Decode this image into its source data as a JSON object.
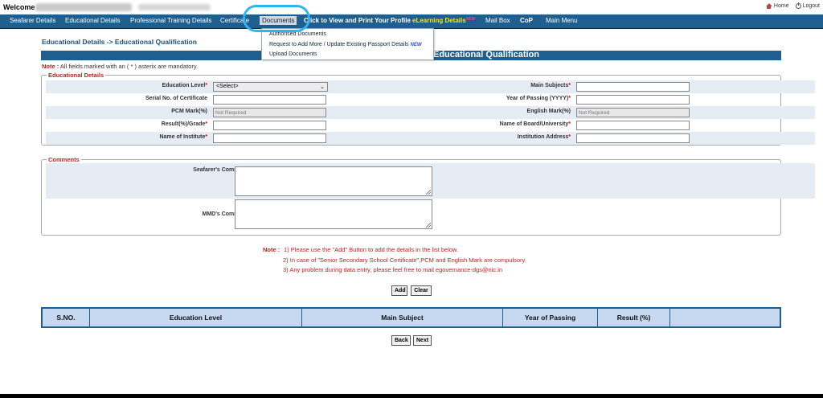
{
  "topbar": {
    "welcome": "Welcome",
    "home": "Home",
    "logout": "Logout"
  },
  "nav": {
    "items": [
      {
        "label": "Seafarer Details"
      },
      {
        "label": "Educational Details"
      },
      {
        "label": "Professional Training Details"
      },
      {
        "label": "Certificate"
      },
      {
        "label": "Documents"
      },
      {
        "label": "Click to View and Print Your Profile"
      },
      {
        "label": "eLearning Details"
      },
      {
        "label": "Mail Box"
      },
      {
        "label": "CoP"
      },
      {
        "label": "Main Menu"
      }
    ],
    "new_tag": "NEW"
  },
  "dropdown": {
    "items": [
      "Authorised Documents",
      "Request to Add More / Update Existing Passport Details",
      "Upload Documents"
    ],
    "new_badge": "NEW"
  },
  "breadcrumb": "Educational Details -> Educational Qualification",
  "page_title": "Educational Qualification",
  "mandatory_note": {
    "prefix": "Note :",
    "text": " All fields marked with an ( * ) asterix are mandatory."
  },
  "educational_details": {
    "legend": "Educational Details",
    "star": "*",
    "education_level_label": "Education Level",
    "education_level_value": "<Select>",
    "main_subjects_label": "Main Subjects",
    "serial_no_label": "Serial No. of Certificate",
    "year_of_passing_label": "Year of Passing (YYYY)",
    "pcm_mark_label": "PCM Mark(%)",
    "pcm_mark_placeholder": "Not Required",
    "english_mark_label": "English Mark(%)",
    "english_mark_placeholder": "Not Required",
    "result_label": "Result(%)/Grade",
    "board_label": "Name of Board/University",
    "institute_label": "Name of Institute",
    "institution_address_label": "Institution Address"
  },
  "comments": {
    "legend": "Comments",
    "seafarer_comment_label": "Seafarer's Comment",
    "mmd_comment_label": "MMD's Comment"
  },
  "instructions": {
    "prefix": "Note :",
    "lines": [
      "1) Please use the \"Add\" Button to add the details in the list below.",
      "2) In case of \"Senior Secondary School Certificate\",PCM and English Mark are compulsory.",
      "3) Any problem during data entry, please feel free to mail egovernance-dgs@nic.in"
    ]
  },
  "buttons": {
    "add": "Add",
    "clear": "Clear",
    "back": "Back",
    "next": "Next"
  },
  "table": {
    "columns": [
      "S.NO.",
      "Education Level",
      "Main Subject",
      "Year of Passing",
      "Result (%)",
      ""
    ]
  },
  "colors": {
    "nav_bg": "#1f5f90",
    "highlight_oval": "#2fb6f0",
    "required_red": "#cc0000",
    "grid_header_bg": "#c6d9f1"
  }
}
